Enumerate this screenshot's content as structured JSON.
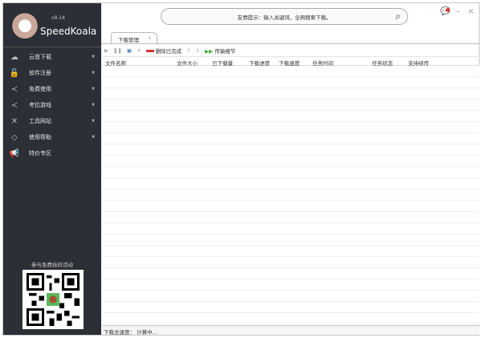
{
  "app": {
    "version": "v9.14",
    "name": "SpeedKoala"
  },
  "sidebar": {
    "items": [
      {
        "icon": "cloud-download-icon",
        "label": "云盘下载",
        "arrow": true
      },
      {
        "icon": "lock-icon",
        "label": "软件注册",
        "arrow": true
      },
      {
        "icon": "share-icon",
        "label": "免费使用",
        "arrow": true
      },
      {
        "icon": "share-icon",
        "label": "考拉游戏",
        "arrow": true
      },
      {
        "icon": "tools-icon",
        "label": "工具网站",
        "arrow": true
      },
      {
        "icon": "tag-icon",
        "label": "使用帮助",
        "arrow": true
      },
      {
        "icon": "megaphone-icon",
        "label": "特价专区",
        "arrow": false
      }
    ],
    "promo": "参与免费抢码活动"
  },
  "search": {
    "placeholder": "友情提示：输入关键词，全网搜索下载。"
  },
  "tabs": [
    {
      "label": "下载管理",
      "close": "×"
    }
  ],
  "toolbar": {
    "delete_completed": "删除已完成",
    "transfer_details": "传输细节"
  },
  "table": {
    "columns": [
      "文件名称",
      "文件大小",
      "已下载量",
      "下载进度",
      "下载速度",
      "任务时间",
      "任务状态",
      "支持续传"
    ]
  },
  "status": {
    "label": "下载总速度：",
    "value": "计算中..."
  },
  "window": {
    "minimize": "–",
    "close": "×"
  }
}
